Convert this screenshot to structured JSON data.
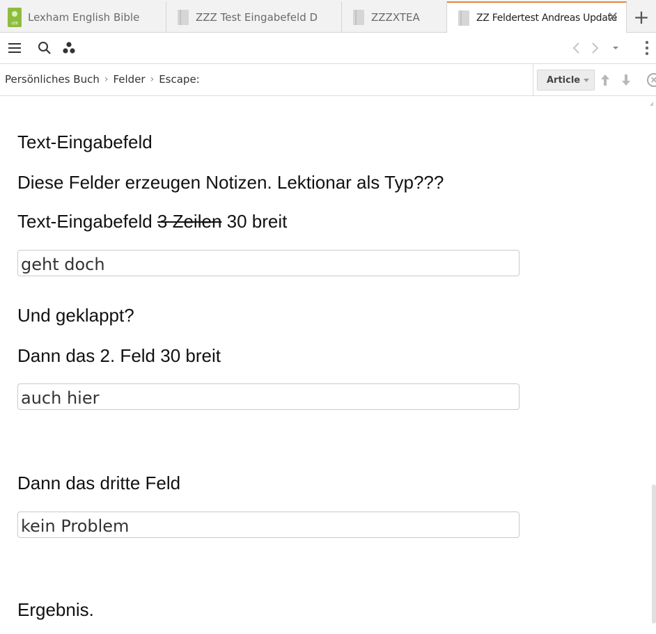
{
  "tabs": [
    {
      "label": "Lexham English Bible",
      "icon": "leb-book-icon"
    },
    {
      "label": "ZZZ Test Eingabefeld D",
      "icon": "book-icon"
    },
    {
      "label": "ZZZXTEA",
      "icon": "book-icon"
    },
    {
      "label": "ZZ Feldertest Andreas Update",
      "icon": "book-icon",
      "active": true
    }
  ],
  "tab_close": "✕",
  "tab_add": "+",
  "toolbar": {
    "icons": [
      "menu-icon",
      "search-icon",
      "panels-icon",
      "back-icon",
      "forward-icon",
      "dropdown-icon",
      "more-icon"
    ]
  },
  "breadcrumb": {
    "items": [
      "Persönliches Buch",
      "Felder",
      "Escape:"
    ],
    "separator": "›"
  },
  "view": {
    "mode_label": "Article"
  },
  "content": {
    "heading": "Text-Eingabefeld",
    "line1": "Diese Felder erzeugen Notizen. Lektionar als Typ???",
    "line2_a": "Text-Eingabefeld ",
    "line2_struck": "3 Zeilen",
    "line2_b": " 30 breit",
    "field1": "geht doch",
    "line3": "Und geklappt?",
    "line4": "Dann das 2. Feld 30 breit",
    "field2": "auch hier",
    "line5": "Dann das dritte Feld",
    "field3": "kein Problem",
    "line6": "Ergebnis."
  },
  "colors": {
    "active_tab_accent": "#e5873b",
    "leb_icon": "#8ebd3e"
  }
}
